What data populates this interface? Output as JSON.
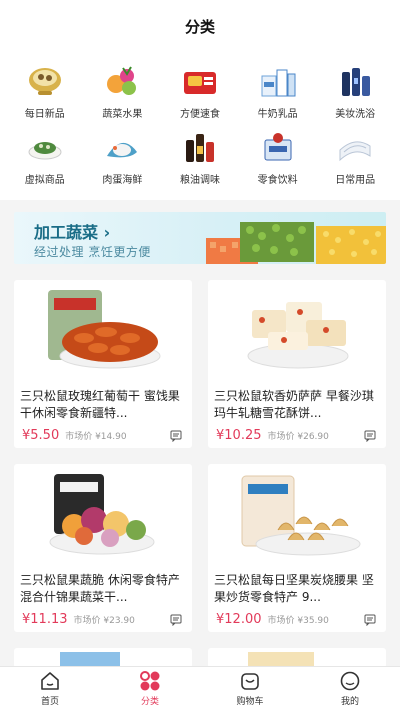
{
  "header": {
    "title": "分类"
  },
  "categories": [
    {
      "label": "每日新品",
      "icon": "bowl-icon"
    },
    {
      "label": "蔬菜水果",
      "icon": "fruit-icon"
    },
    {
      "label": "方便速食",
      "icon": "noodle-pack-icon"
    },
    {
      "label": "牛奶乳品",
      "icon": "milk-icon"
    },
    {
      "label": "美妆洗浴",
      "icon": "cosmetics-icon"
    },
    {
      "label": "虚拟商品",
      "icon": "dish-icon"
    },
    {
      "label": "肉蛋海鲜",
      "icon": "seafood-icon"
    },
    {
      "label": "粮油调味",
      "icon": "condiment-icon"
    },
    {
      "label": "零食饮料",
      "icon": "snack-icon"
    },
    {
      "label": "日常用品",
      "icon": "towel-icon"
    }
  ],
  "banner": {
    "title": "加工蔬菜",
    "arrow": "›",
    "subtitle": "经过处理 烹饪更方便"
  },
  "products": [
    {
      "name": "三只松鼠玫瑰红葡萄干 蜜饯果干休闲零食新疆特...",
      "price": "¥5.50",
      "market": "市场价 ¥14.90"
    },
    {
      "name": "三只松鼠软香奶萨萨 早餐沙琪玛牛轧糖雪花酥饼...",
      "price": "¥10.25",
      "market": "市场价 ¥26.90"
    },
    {
      "name": "三只松鼠果蔬脆 休闲零食特产混合什锦果蔬菜干...",
      "price": "¥11.13",
      "market": "市场价 ¥23.90"
    },
    {
      "name": "三只松鼠每日坚果炭烧腰果 坚果炒货零食特产 9...",
      "price": "¥12.00",
      "market": "市场价 ¥35.90"
    }
  ],
  "tabs": [
    {
      "label": "首页",
      "icon": "home-icon"
    },
    {
      "label": "分类",
      "icon": "category-icon"
    },
    {
      "label": "购物车",
      "icon": "cart-icon"
    },
    {
      "label": "我的",
      "icon": "profile-icon"
    }
  ],
  "colors": {
    "accent": "#e23a5a",
    "banner_text": "#1a6d87"
  }
}
